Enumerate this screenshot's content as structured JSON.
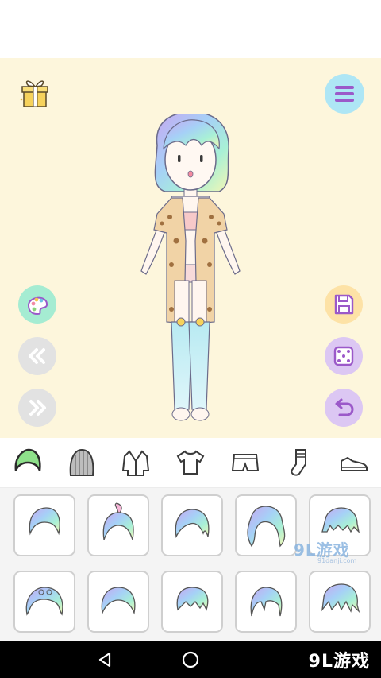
{
  "colors": {
    "stage_bg": "#fdf6dc",
    "palette_btn": "#a5ecd2",
    "nav_btn": "#e2e2e2",
    "save_btn": "#fde2a6",
    "random_btn": "#dcc7f3",
    "undo_btn": "#dcc7f3",
    "menu_btn": "#aee6f5",
    "accent_purple": "#9b59c9"
  },
  "icons": {
    "gift": "gift-icon",
    "menu": "menu-icon",
    "palette": "palette-icon",
    "prev": "double-chevron-left-icon",
    "next": "double-chevron-right-icon",
    "save": "floppy-disk-icon",
    "random": "dice-icon",
    "undo": "undo-icon"
  },
  "categories": [
    {
      "id": "hair",
      "icon": "hair-icon",
      "selected": true
    },
    {
      "id": "hat",
      "icon": "knit-hat-icon",
      "selected": false
    },
    {
      "id": "jacket",
      "icon": "jacket-icon",
      "selected": false
    },
    {
      "id": "top",
      "icon": "tshirt-icon",
      "selected": false
    },
    {
      "id": "bottom",
      "icon": "shorts-icon",
      "selected": false
    },
    {
      "id": "socks",
      "icon": "sock-icon",
      "selected": false
    },
    {
      "id": "shoes",
      "icon": "shoe-icon",
      "selected": false
    }
  ],
  "hair_items": [
    {
      "style": "short-crop"
    },
    {
      "style": "ponytail-bob"
    },
    {
      "style": "wavy-bob"
    },
    {
      "style": "long-wavy"
    },
    {
      "style": "spiky-short"
    },
    {
      "style": "curly-bob"
    },
    {
      "style": "side-bob"
    },
    {
      "style": "layered-bob"
    },
    {
      "style": "straight-bob"
    },
    {
      "style": "messy-short"
    }
  ],
  "watermark": {
    "big": "9L游戏",
    "small": "91danji.com"
  },
  "navbar": {
    "brand": "9L游戏"
  }
}
